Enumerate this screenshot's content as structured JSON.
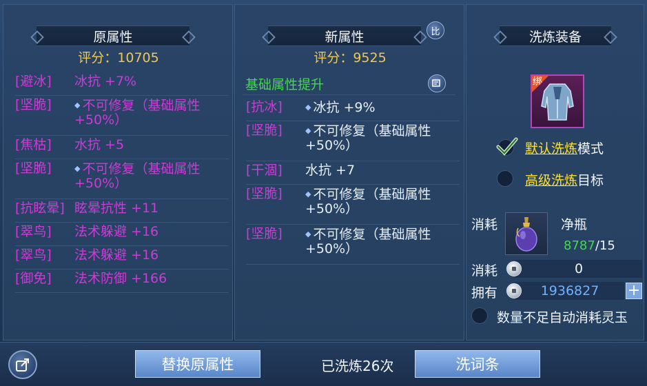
{
  "left": {
    "title": "原属性",
    "score": "评分：10705",
    "rows": [
      {
        "tag": "[避冰]",
        "value": "冰抗 +7%",
        "dot": false
      },
      {
        "tag": "[坚脆]",
        "value": "不可修复（基础属性",
        "value2": "+50%）",
        "dot": true
      },
      {
        "tag": "[焦枯]",
        "value": "水抗 +5",
        "dot": false
      },
      {
        "tag": "[坚脆]",
        "value": "不可修复（基础属性",
        "value2": "+50%）",
        "dot": true
      },
      {
        "tag": "[抗眩晕]",
        "value": "眩晕抗性 +11",
        "dot": false
      },
      {
        "tag": "[翠鸟]",
        "value": "法术躲避 +16",
        "dot": false
      },
      {
        "tag": "[翠鸟]",
        "value": "法术躲避 +16",
        "dot": false
      },
      {
        "tag": "[御免]",
        "value": "法术防御 +166",
        "dot": false
      }
    ]
  },
  "mid": {
    "title": "新属性",
    "compare_icon": "比",
    "score": "评分：9525",
    "boost_label": "基础属性提升",
    "rows": [
      {
        "tag": "[抗冰]",
        "value": "冰抗 +9%",
        "dot": true
      },
      {
        "tag": "[坚脆]",
        "value": "不可修复（基础属性",
        "value2": "+50%）",
        "dot": true
      },
      {
        "tag": "[干涸]",
        "value": "水抗 +7",
        "dot": false
      },
      {
        "tag": "[坚脆]",
        "value": "不可修复（基础属性",
        "value2": "+50%）",
        "dot": true
      },
      {
        "tag": "[坚脆]",
        "value": "不可修复（基础属性",
        "value2": "+50%）",
        "dot": true
      }
    ]
  },
  "right": {
    "title": "洗炼装备",
    "bind_label": "绑",
    "mode_default_ul": "默认洗炼",
    "mode_default_rest": "模式",
    "mode_advanced_ul": "高级洗炼",
    "mode_advanced_rest": "目标",
    "consume_label": "消耗",
    "item_name": "净瓶",
    "item_have": "8787",
    "item_need": "/15",
    "consume2_label": "消耗",
    "consume2_value": "0",
    "own_label": "拥有",
    "own_value": "1936827",
    "plus_label": "+",
    "auto_label": "数量不足自动消耗灵玉"
  },
  "bottom": {
    "replace_label": "替换原属性",
    "wash_count": "已洗炼26次",
    "wash_label": "洗词条"
  },
  "colors": {
    "accent_gold": "#f1c94a",
    "attribute_pink": "#cc3bd6",
    "green": "#43d94b",
    "link_yellow": "#ffe02a"
  }
}
